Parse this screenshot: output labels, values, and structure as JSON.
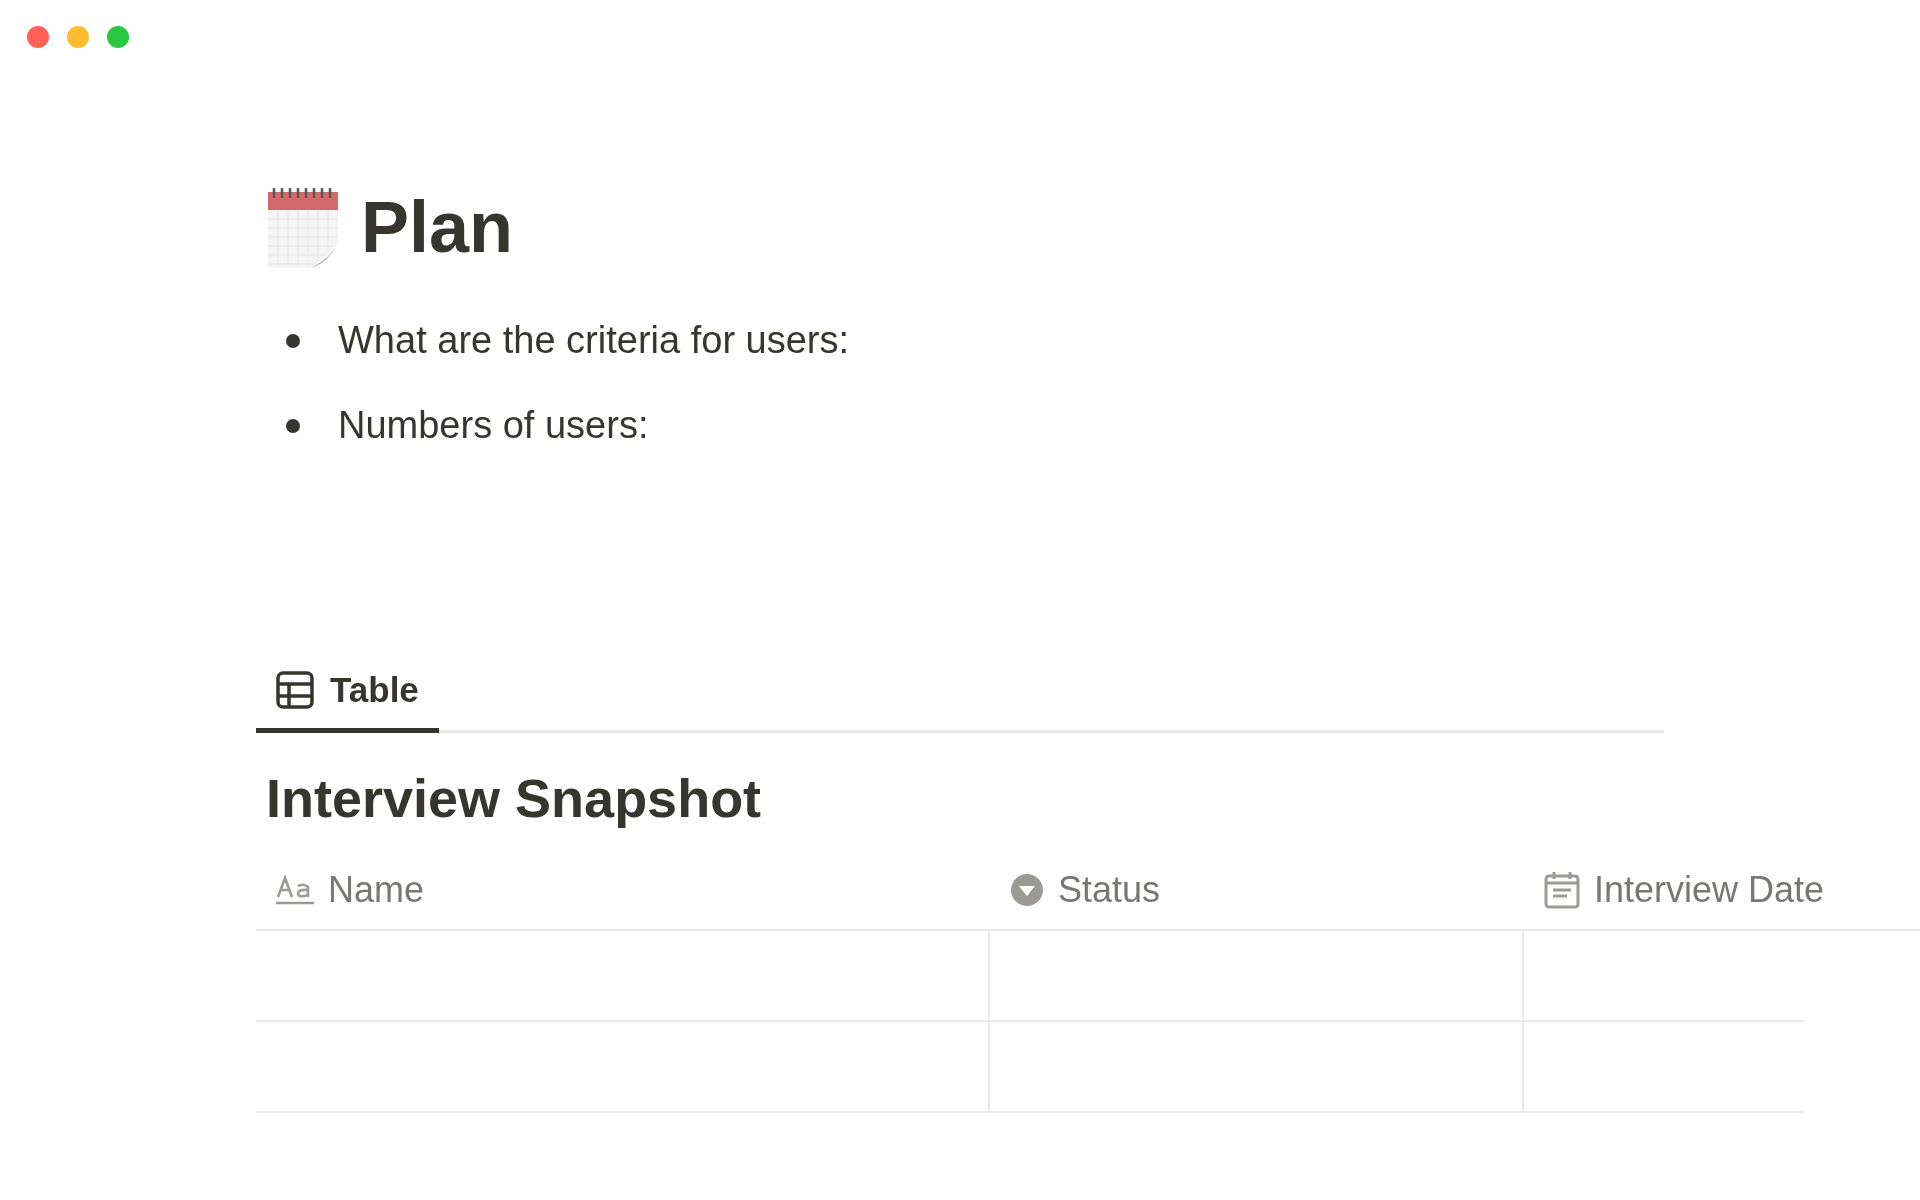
{
  "window": {
    "controls": [
      {
        "color": "#fe5f57"
      },
      {
        "color": "#febc2e"
      },
      {
        "color": "#28c840"
      }
    ]
  },
  "page": {
    "title": "Plan"
  },
  "bullets": [
    "What are the criteria for users:",
    "Numbers of users:"
  ],
  "views": [
    {
      "label": "Table",
      "selected": true
    }
  ],
  "database": {
    "title": "Interview Snapshot",
    "columns": [
      {
        "label": "Name",
        "kind": "text"
      },
      {
        "label": "Status",
        "kind": "select"
      },
      {
        "label": "Interview Date",
        "kind": "date"
      }
    ]
  }
}
